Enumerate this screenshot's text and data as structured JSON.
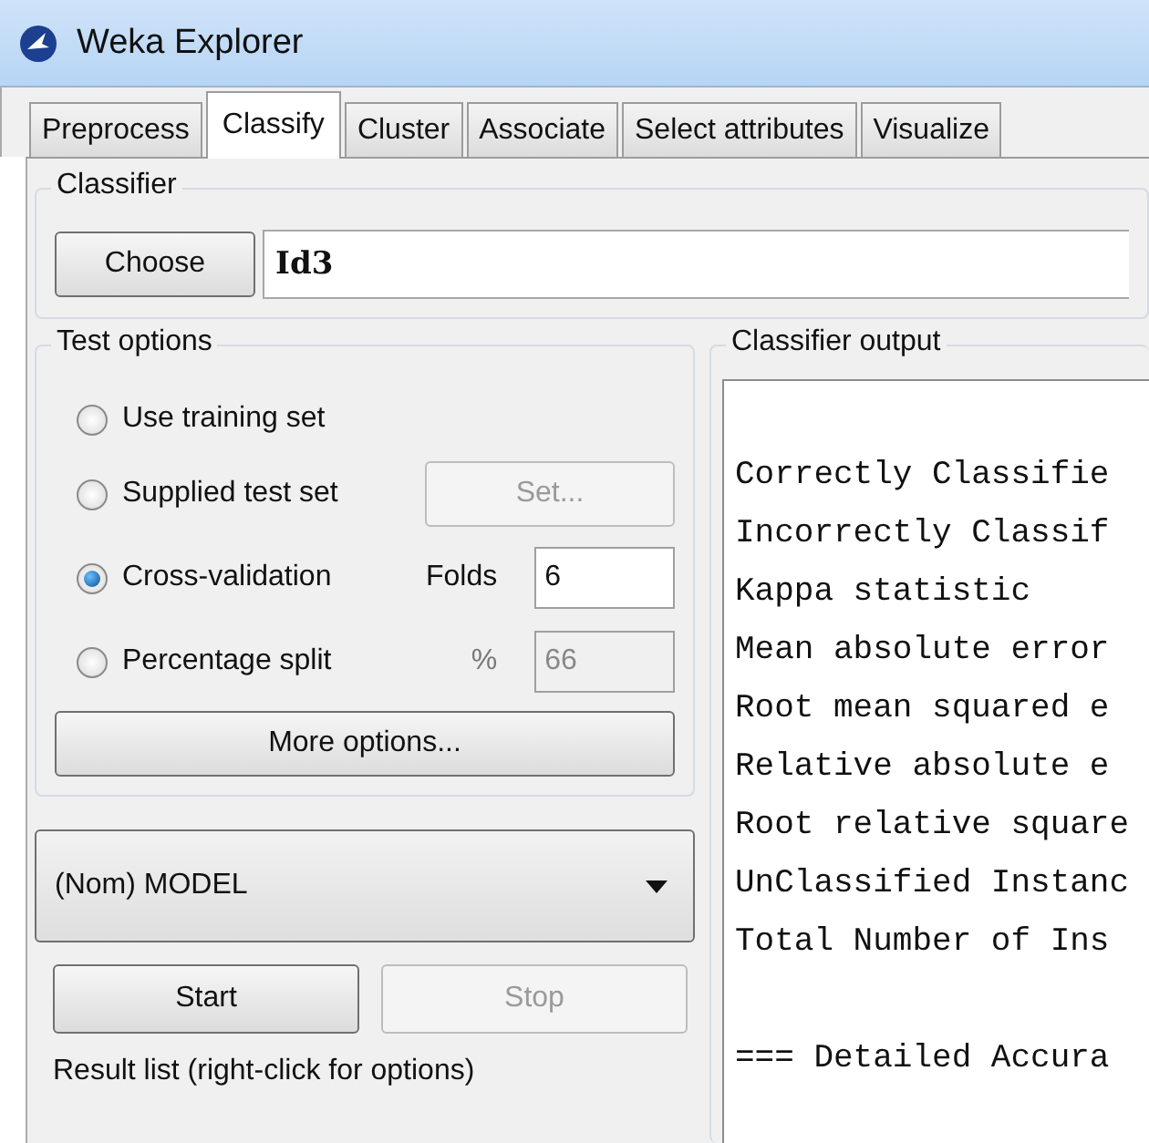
{
  "window": {
    "title": "Weka Explorer"
  },
  "tabs": [
    {
      "label": "Preprocess",
      "selected": false
    },
    {
      "label": "Classify",
      "selected": true
    },
    {
      "label": "Cluster",
      "selected": false
    },
    {
      "label": "Associate",
      "selected": false
    },
    {
      "label": "Select attributes",
      "selected": false
    },
    {
      "label": "Visualize",
      "selected": false
    }
  ],
  "classifier": {
    "title": "Classifier",
    "button": "Choose",
    "value": "Id3"
  },
  "test_options": {
    "title": "Test options",
    "options": [
      {
        "kind": "plain",
        "label": "Use training set",
        "selected": false
      },
      {
        "kind": "button",
        "label": "Supplied test set",
        "selected": false,
        "button": "Set...",
        "disabled": true
      },
      {
        "kind": "field",
        "label": "Cross-validation",
        "selected": true,
        "field_label": "Folds",
        "value": "6",
        "disabled": false
      },
      {
        "kind": "field",
        "label": "Percentage split",
        "selected": false,
        "field_label": "%",
        "value": "66",
        "disabled": true
      }
    ],
    "more_button": "More options..."
  },
  "class_dropdown": {
    "value": "(Nom) MODEL"
  },
  "run_buttons": [
    {
      "label": "Start",
      "disabled": false
    },
    {
      "label": "Stop",
      "disabled": true
    }
  ],
  "result_list": {
    "title": "Result list (right-click for options)"
  },
  "output": {
    "title": "Classifier output",
    "blocks": [
      {
        "lines": [
          "Correctly Classifie",
          "Incorrectly Classif",
          "Kappa statistic",
          "Mean absolute error",
          "Root mean squared e",
          "Relative absolute e",
          "Root relative square",
          "UnClassified Instanc",
          "Total Number of Ins"
        ]
      },
      {
        "lines": [
          "=== Detailed Accura"
        ]
      }
    ]
  }
}
